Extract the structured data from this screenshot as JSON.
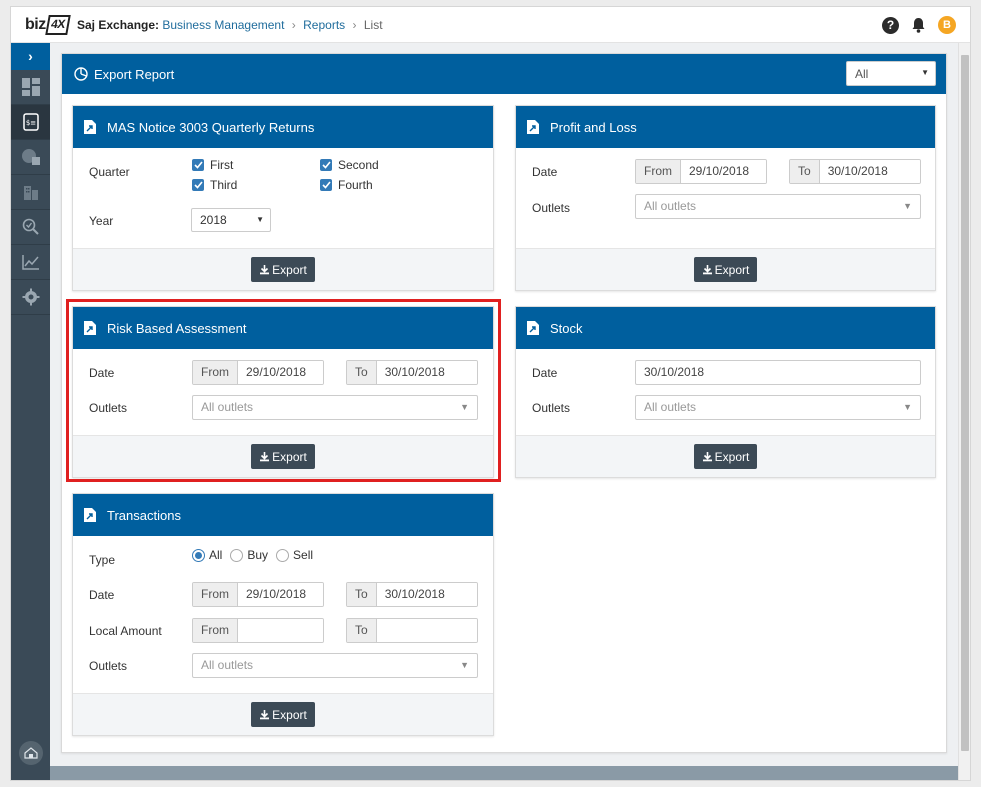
{
  "app": {
    "logo_main": "biz",
    "logo_box": "4X",
    "org": "Saj Exchange:",
    "breadcrumb": [
      "Business Management",
      "Reports",
      "List"
    ],
    "avatar_letter": "B"
  },
  "panel": {
    "title": "Export Report",
    "filter_value": "All"
  },
  "cards": {
    "mas": {
      "title": "MAS Notice 3003 Quarterly Returns",
      "quarter_label": "Quarter",
      "year_label": "Year",
      "quarters": [
        "First",
        "Second",
        "Third",
        "Fourth"
      ],
      "year_value": "2018",
      "export": "Export"
    },
    "pnl": {
      "title": "Profit and Loss",
      "date_label": "Date",
      "outlets_label": "Outlets",
      "from": "From",
      "to": "To",
      "from_value": "29/10/2018",
      "to_value": "30/10/2018",
      "outlets_placeholder": "All outlets",
      "export": "Export"
    },
    "rba": {
      "title": "Risk Based Assessment",
      "date_label": "Date",
      "outlets_label": "Outlets",
      "from": "From",
      "to": "To",
      "from_value": "29/10/2018",
      "to_value": "30/10/2018",
      "outlets_placeholder": "All outlets",
      "export": "Export"
    },
    "stock": {
      "title": "Stock",
      "date_label": "Date",
      "outlets_label": "Outlets",
      "date_value": "30/10/2018",
      "outlets_placeholder": "All outlets",
      "export": "Export"
    },
    "txn": {
      "title": "Transactions",
      "type_label": "Type",
      "types": [
        "All",
        "Buy",
        "Sell"
      ],
      "date_label": "Date",
      "amount_label": "Local Amount",
      "outlets_label": "Outlets",
      "from": "From",
      "to": "To",
      "from_value": "29/10/2018",
      "to_value": "30/10/2018",
      "outlets_placeholder": "All outlets",
      "export": "Export"
    }
  },
  "colors": {
    "header_blue": "#005f9e",
    "sidebar": "#3a4a57",
    "export_btn": "#3c4a56",
    "highlight": "#e02020"
  }
}
